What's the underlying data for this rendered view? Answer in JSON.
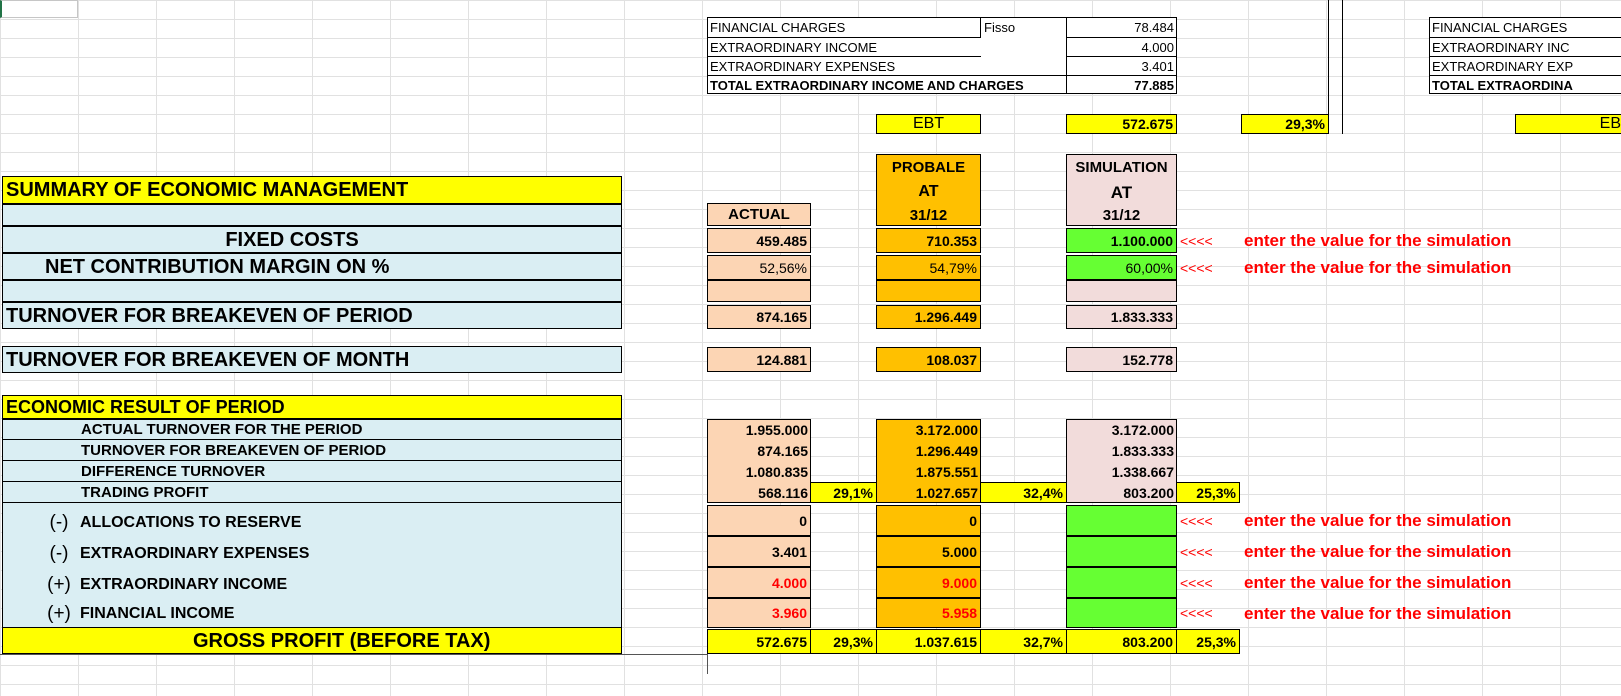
{
  "top_table": {
    "rows": [
      {
        "label": "FINANCIAL CHARGES",
        "tag": "Fisso",
        "value": "78.484"
      },
      {
        "label": "EXTRAORDINARY INCOME",
        "tag": "",
        "value": "4.000"
      },
      {
        "label": "EXTRAORDINARY EXPENSES",
        "tag": "",
        "value": "3.401"
      }
    ],
    "total_label": "TOTAL EXTRAORDINARY INCOME AND CHARGES",
    "total_value": "77.885",
    "ebt_label": "EBT",
    "ebt_value": "572.675",
    "ebt_pct": "29,3%"
  },
  "right_partial": {
    "rows": [
      "FINANCIAL CHARGES",
      "EXTRAORDINARY INC",
      "EXTRAORDINARY EXP",
      "TOTAL EXTRAORDINA"
    ],
    "ebt": "EB"
  },
  "headers": {
    "actual": "ACTUAL",
    "probale_1": "PROBALE",
    "probale_2": "AT",
    "probale_3": "31/12",
    "sim_1": "SIMULATION",
    "sim_2": "AT",
    "sim_3": "31/12"
  },
  "summary": {
    "title": "SUMMARY OF ECONOMIC MANAGEMENT",
    "fixed_costs_label": "FIXED COSTS",
    "fixed_costs": {
      "actual": "459.485",
      "probale": "710.353",
      "sim": "1.100.000"
    },
    "ncm_label": "NET CONTRIBUTION MARGIN ON %",
    "ncm": {
      "actual": "52,56%",
      "probale": "54,79%",
      "sim": "60,00%"
    },
    "tbe_period_label": "TURNOVER FOR BREAKEVEN OF PERIOD",
    "tbe_period": {
      "actual": "874.165",
      "probale": "1.296.449",
      "sim": "1.833.333"
    },
    "tbe_month_label": "TURNOVER FOR BREAKEVEN OF MONTH",
    "tbe_month": {
      "actual": "124.881",
      "probale": "108.037",
      "sim": "152.778"
    }
  },
  "arrow": "<<<<",
  "hint": "enter the value for the simulation",
  "result": {
    "title": "ECONOMIC RESULT OF PERIOD",
    "rows": [
      {
        "label": "ACTUAL TURNOVER FOR THE PERIOD",
        "actual": "1.955.000",
        "probale": "3.172.000",
        "sim": "3.172.000"
      },
      {
        "label": "TURNOVER FOR BREAKEVEN OF PERIOD",
        "actual": "874.165",
        "probale": "1.296.449",
        "sim": "1.833.333"
      },
      {
        "label": "DIFFERENCE TURNOVER",
        "actual": "1.080.835",
        "probale": "1.875.551",
        "sim": "1.338.667"
      },
      {
        "label": "TRADING PROFIT",
        "actual": "568.116",
        "actual_pct": "29,1%",
        "probale": "1.027.657",
        "probale_pct": "32,4%",
        "sim": "803.200",
        "sim_pct": "25,3%"
      }
    ],
    "adjust": [
      {
        "sign": "(-)",
        "label": "ALLOCATIONS TO RESERVE",
        "actual": "0",
        "probale": "0"
      },
      {
        "sign": "(-)",
        "label": "EXTRAORDINARY EXPENSES",
        "actual": "3.401",
        "probale": "5.000"
      },
      {
        "sign": "(+)",
        "label": "EXTRAORDINARY INCOME",
        "actual": "4.000",
        "probale": "9.000"
      },
      {
        "sign": "(+)",
        "label": "FINANCIAL INCOME",
        "actual": "3.960",
        "probale": "5.958"
      }
    ],
    "gross_label": "GROSS PROFIT (BEFORE TAX)",
    "gross": {
      "actual": "572.675",
      "actual_pct": "29,3%",
      "probale": "1.037.615",
      "probale_pct": "32,7%",
      "sim": "803.200",
      "sim_pct": "25,3%"
    }
  },
  "colors": {
    "yellow": "#ffff00",
    "light_blue": "#daeef3",
    "peach": "#fcd5b4",
    "orange": "#ffc000",
    "pink": "#f2dcdb",
    "green": "#66ff33",
    "red": "#ff0000"
  }
}
